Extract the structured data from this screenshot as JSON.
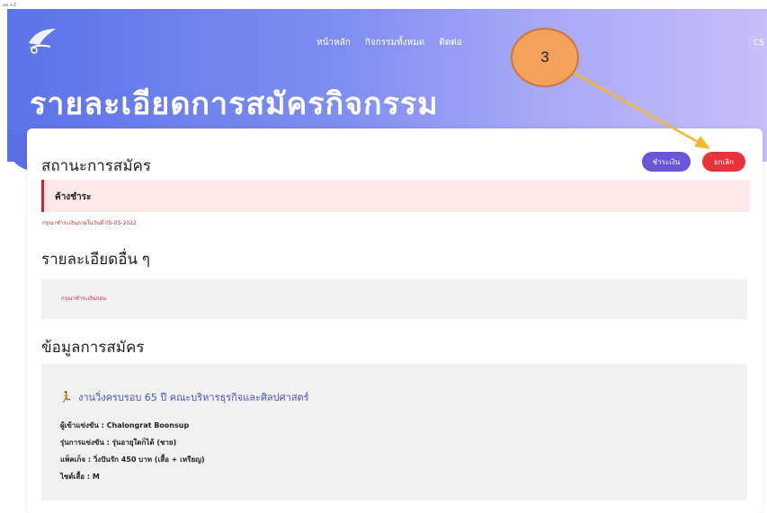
{
  "corner_tag": "aa +2",
  "nav": {
    "home": "หน้าหลัก",
    "all_activities": "กิจกรรมทั้งหมด",
    "contact": "ติดต่อ"
  },
  "avatar": "CS",
  "page_title": "รายละเอียดการสมัครกิจกรรม",
  "status": {
    "title": "สถานะการสมัคร",
    "pay_button": "ชำระเงิน",
    "cancel_button": "ยกเลิก",
    "alert": "ค้างชำระ",
    "deadline": "กรุณาชำระเงินภายในวันที่ 05-05-2022"
  },
  "other_details": {
    "title": "รายละเอียดอื่น ๆ",
    "note": "กรุณาชำระเงินก่อน"
  },
  "registration": {
    "title": "ข้อมูลการสมัคร",
    "event_name": "งานวิ่งครบรอบ 65 ปี คณะบริหารธุรกิจและศิลปศาสตร์",
    "competitor": "ผู้เข้าแข่งขัน : Chalongrat Boonsup",
    "division": "รุ่นการแข่งขัน : รุ่นอายุใดก็ได้ (ชาย)",
    "package": "แพ็คเก็จ : วิ่งปันรัก 450 บาท (เสื้อ + เหรียญ)",
    "shirt_size": "ไซต์เสื้อ : M"
  },
  "annotation_number": "3",
  "colors": {
    "accent": "#6a55d8",
    "danger": "#e8333d",
    "annotation": "#f4a15c",
    "arrow": "#f2b830"
  }
}
